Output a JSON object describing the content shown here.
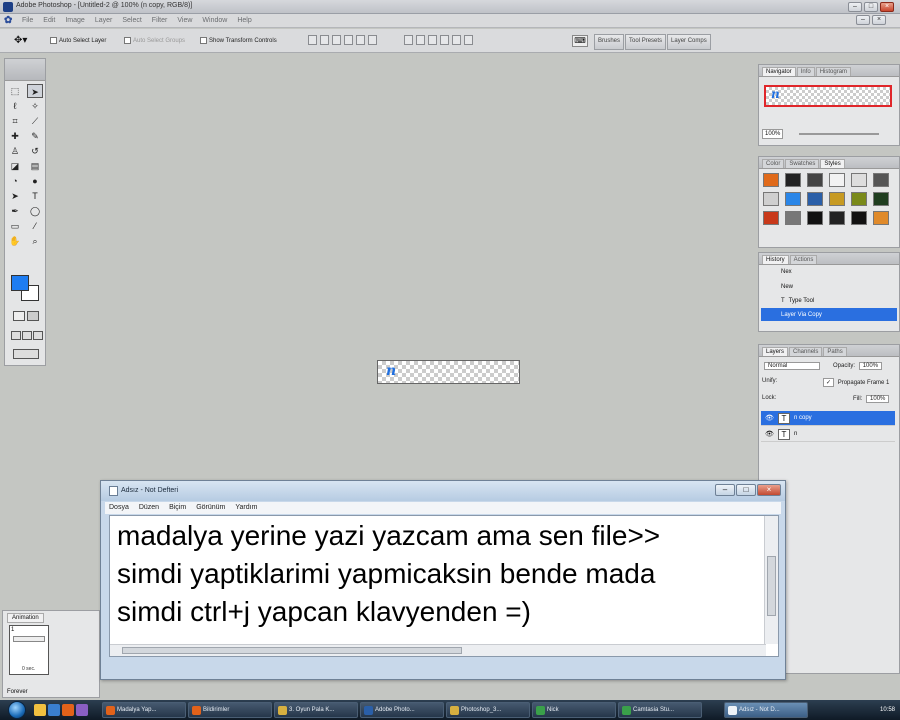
{
  "window": {
    "title": "Adobe Photoshop - [Untitled-2 @ 100% (n copy, RGB/8)]"
  },
  "menubar": {
    "items": [
      "File",
      "Edit",
      "Image",
      "Layer",
      "Select",
      "Filter",
      "View",
      "Window",
      "Help"
    ]
  },
  "options": {
    "auto_select_layer": "Auto Select Layer",
    "auto_select_groups": "Auto Select Groups",
    "show_transform_controls": "Show Transform Controls",
    "palette_well": [
      "Brushes",
      "Tool Presets",
      "Layer Comps"
    ]
  },
  "canvas": {
    "glyph": "n",
    "colors": {
      "glyph": "#1f6fe0",
      "foreground": "#1e7df2"
    }
  },
  "navigator": {
    "tabs": [
      "Navigator",
      "Info",
      "Histogram"
    ],
    "zoom": "100%"
  },
  "styles_panel": {
    "tabs": [
      "Color",
      "Swatches",
      "Styles"
    ],
    "swatches": [
      "#e06a1a",
      "#222222",
      "#444444",
      "#f2f2f2",
      "#dddddd",
      "#555555",
      "#cfcfcf",
      "#2a86e8",
      "#2a5fa8",
      "#c79a22",
      "#7a8a1a",
      "#1f3d1f",
      "#c8391a",
      "#777777",
      "#111111",
      "#222222",
      "#111111",
      "#e08a2a"
    ]
  },
  "history": {
    "tabs": [
      "History",
      "Actions"
    ],
    "snapshot": "Nex",
    "items": [
      "New",
      "Type Tool",
      "Layer Via Copy"
    ]
  },
  "layers": {
    "tabs": [
      "Layers",
      "Channels",
      "Paths"
    ],
    "blend_mode": "Normal",
    "opacity_label": "Opacity:",
    "opacity": "100%",
    "unify_label": "Unify:",
    "propagate": "Propagate Frame 1",
    "lock_label": "Lock:",
    "fill_label": "Fill:",
    "fill": "100%",
    "rows": [
      {
        "name": "n copy",
        "selected": true
      },
      {
        "name": "n",
        "selected": false
      }
    ]
  },
  "animation": {
    "tab": "Animation",
    "frame_number": "1",
    "frame_delay": "0 sec.",
    "loop": "Forever"
  },
  "notepad": {
    "title": "Adsız - Not Defteri",
    "menu": [
      "Dosya",
      "Düzen",
      "Biçim",
      "Görünüm",
      "Yardım"
    ],
    "lines": [
      "madalya yerine yazi yazcam ama sen file>>",
      "simdi yaptiklarimi yapmicaksin bende mada",
      "simdi ctrl+j yapcan klavyenden =)"
    ]
  },
  "taskbar": {
    "tasks": [
      {
        "label": "Madalya Yap...",
        "active": false
      },
      {
        "label": "Bildirimler",
        "active": false
      },
      {
        "label": "3. Oyun Pala K...",
        "active": false
      },
      {
        "label": "Adobe Photo...",
        "active": false
      },
      {
        "label": "Photoshop_3...",
        "active": false
      },
      {
        "label": "Nick",
        "active": false
      },
      {
        "label": "Camtasia Stu...",
        "active": false
      },
      {
        "label": "Adsız - Not D...",
        "active": true
      }
    ],
    "clock": "10:58"
  }
}
